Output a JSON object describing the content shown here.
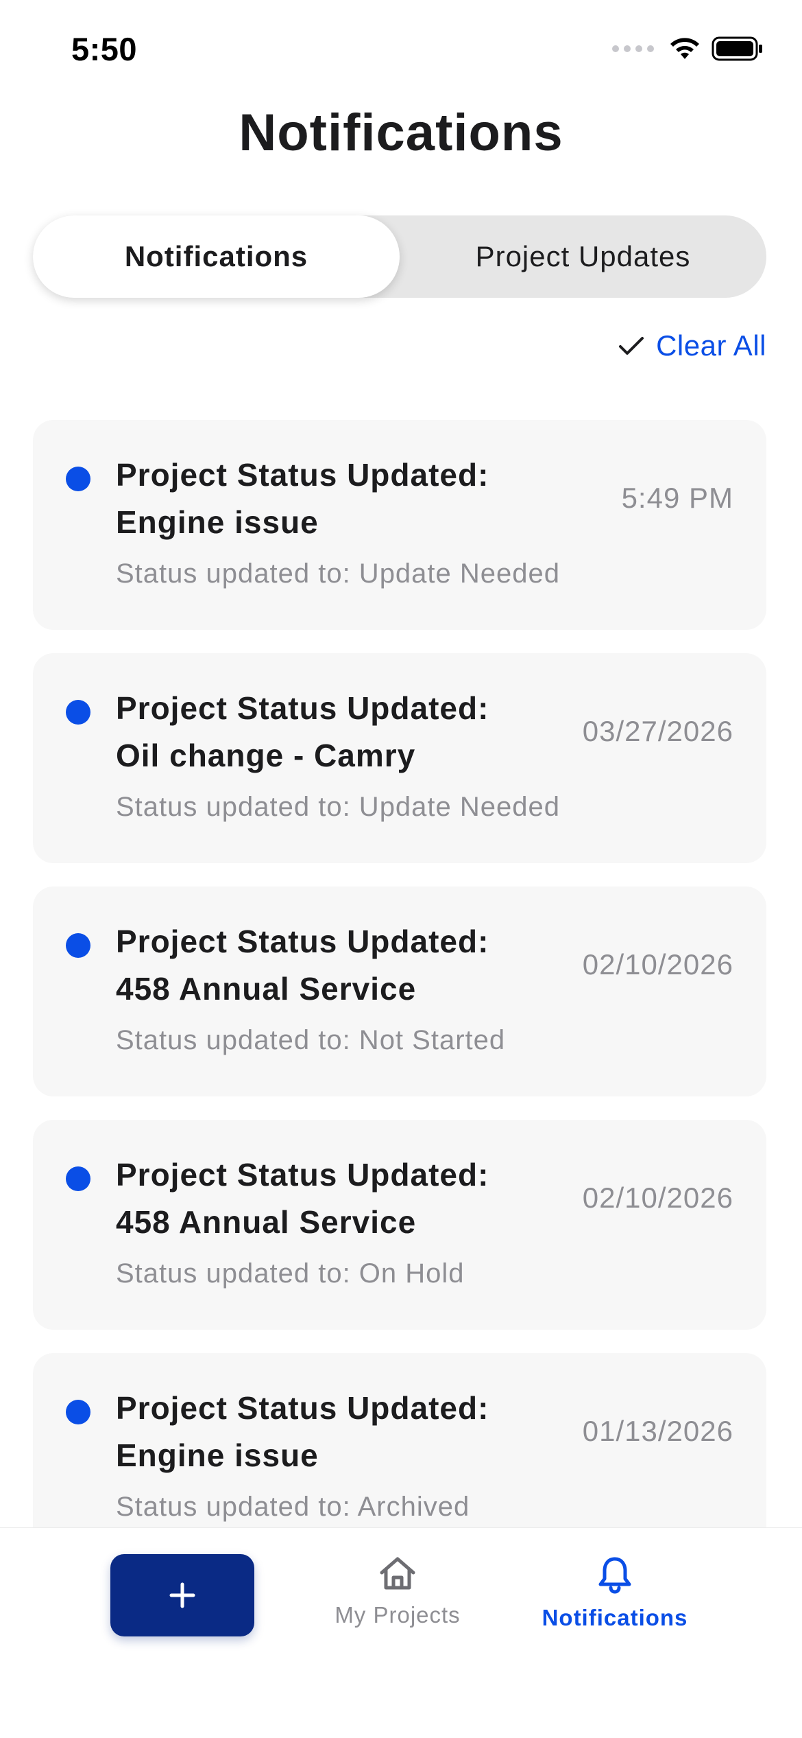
{
  "status_bar": {
    "time": "5:50"
  },
  "header": {
    "title": "Notifications"
  },
  "segmented_control": {
    "tabs": [
      {
        "label": "Notifications",
        "selected": true
      },
      {
        "label": "Project Updates",
        "selected": false
      }
    ]
  },
  "actions": {
    "clear_all_label": "Clear All"
  },
  "notifications": [
    {
      "title": "Project Status Updated: Engine issue",
      "date": "5:49 PM",
      "body": "Status updated to: Update Needed",
      "unread": true
    },
    {
      "title": "Project Status Updated: Oil change - Camry",
      "date": "03/27/2026",
      "body": "Status updated to: Update Needed",
      "unread": true
    },
    {
      "title": "Project Status Updated: 458 Annual Service",
      "date": "02/10/2026",
      "body": "Status updated to: Not Started",
      "unread": true
    },
    {
      "title": "Project Status Updated: 458 Annual Service",
      "date": "02/10/2026",
      "body": "Status updated to: On Hold",
      "unread": true
    },
    {
      "title": "Project Status Updated: Engine issue",
      "date": "01/13/2026",
      "body": "Status updated to: Archived",
      "unread": true
    }
  ],
  "tab_bar": {
    "add_icon": "plus-icon",
    "items": [
      {
        "label": "My Projects",
        "icon": "home-icon",
        "active": false
      },
      {
        "label": "Notifications",
        "icon": "bell-icon",
        "active": true
      }
    ]
  },
  "colors": {
    "accent": "#0a4ee6",
    "fab": "#0a2a85",
    "card_bg": "#f7f7f7",
    "segment_bg": "#e6e6e6",
    "muted_text": "#8e8e93"
  }
}
